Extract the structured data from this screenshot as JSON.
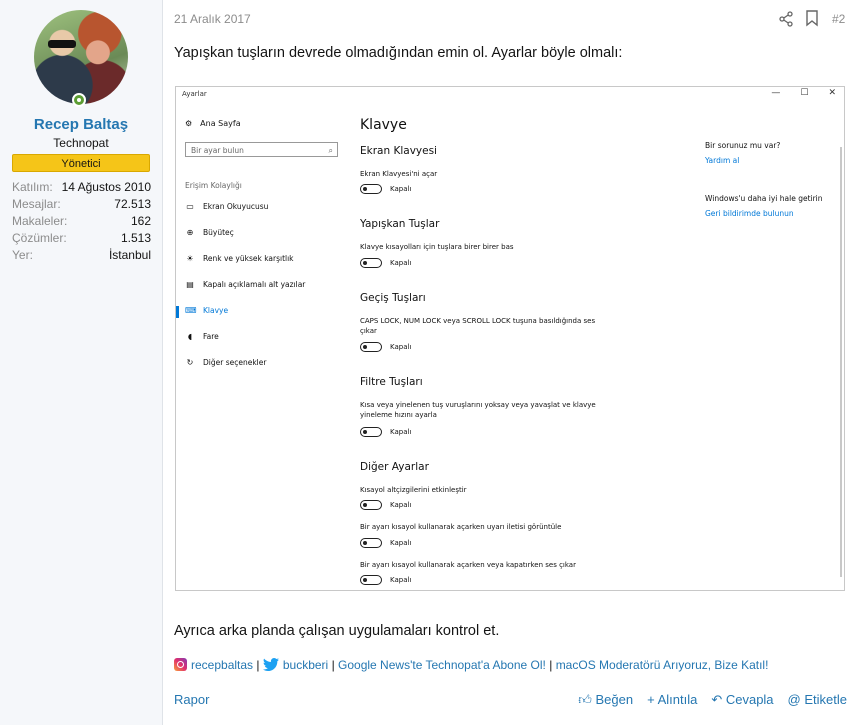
{
  "user": {
    "name": "Recep Baltaş",
    "title": "Technopat",
    "badge": "Yönetici",
    "stats": [
      {
        "k": "Katılım:",
        "v": "14 Ağustos 2010"
      },
      {
        "k": "Mesajlar:",
        "v": "72.513"
      },
      {
        "k": "Makaleler:",
        "v": "162"
      },
      {
        "k": "Çözümler:",
        "v": "1.513"
      },
      {
        "k": "Yer:",
        "v": "İstanbul"
      }
    ]
  },
  "post": {
    "date": "21 Aralık 2017",
    "number": "#2",
    "line1": "Yapışkan tuşların devrede olmadığından emin ol. Ayarlar böyle olmalı:",
    "line2": "Ayrıca arka planda çalışan uygulamaları kontrol et.",
    "signature": {
      "instagram": "recepbaltas",
      "twitter": "buckberi",
      "link1": "Google News'te Technopat'a Abone Ol!",
      "link2": "macOS Moderatörü Arıyoruz, Bize Katıl!",
      "sep": "|"
    },
    "actions": {
      "report": "Rapor",
      "like": "Beğen",
      "quote": "+ Alıntıla",
      "reply": "Cevapla",
      "tag": "@ Etiketle"
    }
  },
  "screenshot": {
    "window_title": "Ayarlar",
    "win_buttons": [
      "—",
      "☐",
      "✕"
    ],
    "home": "Ana Sayfa",
    "search_placeholder": "Bir ayar bulun",
    "category": "Erişim Kolaylığı",
    "nav": [
      {
        "icon": "▭",
        "label": "Ekran Okuyucusu"
      },
      {
        "icon": "⊕",
        "label": "Büyüteç"
      },
      {
        "icon": "☀",
        "label": "Renk ve yüksek karşıtlık"
      },
      {
        "icon": "▤",
        "label": "Kapalı açıklamalı alt yazılar"
      },
      {
        "icon": "⌨",
        "label": "Klavye"
      },
      {
        "icon": "◖",
        "label": "Fare"
      },
      {
        "icon": "↻",
        "label": "Diğer seçenekler"
      }
    ],
    "heading": "Klavye",
    "sections": [
      {
        "title": "Ekran Klavyesi",
        "desc": "Ekran Klavyesi'ni açar",
        "state": "Kapalı"
      },
      {
        "title": "Yapışkan Tuşlar",
        "desc": "Klavye kısayolları için tuşlara birer birer bas",
        "state": "Kapalı"
      },
      {
        "title": "Geçiş Tuşları",
        "desc": "CAPS LOCK, NUM LOCK veya SCROLL LOCK tuşuna basıldığında ses çıkar",
        "state": "Kapalı"
      },
      {
        "title": "Filtre Tuşları",
        "desc": "Kısa veya yinelenen tuş vuruşlarını yoksay veya yavaşlat ve klavye yineleme hızını ayarla",
        "state": "Kapalı"
      },
      {
        "title": "Diğer Ayarlar",
        "desc": "Kısayol altçizgilerini etkinleştir",
        "state": "Kapalı"
      }
    ],
    "extra": [
      {
        "desc": "Bir ayarı kısayol kullanarak açarken uyarı iletisi görüntüle",
        "state": "Kapalı"
      },
      {
        "desc": "Bir ayarı kısayol kullanarak açarken veya kapatırken ses çıkar",
        "state": "Kapalı"
      }
    ],
    "side": {
      "q1": "Bir sorunuz mu var?",
      "l1": "Yardım al",
      "q2": "Windows'u daha iyi hale getirin",
      "l2": "Geri bildirimde bulunun"
    }
  }
}
